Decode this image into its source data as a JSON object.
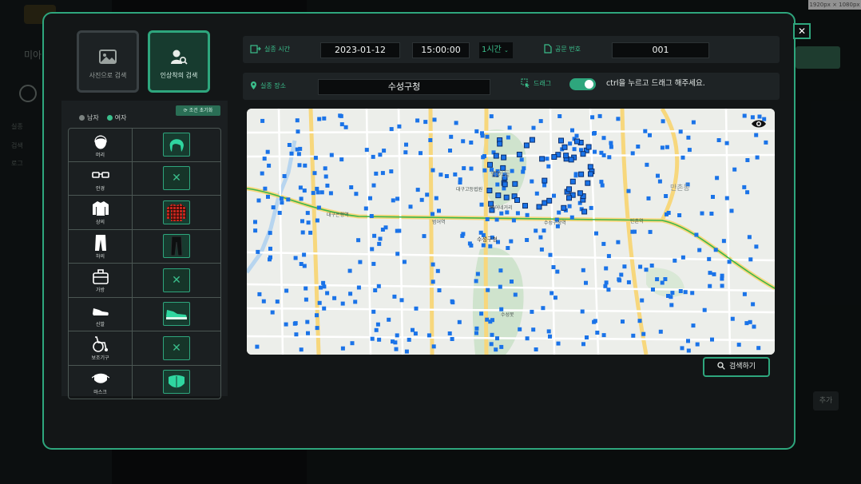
{
  "screen_size_label": "1920px × 1080px",
  "background": {
    "title": "미아",
    "nav_items": [
      "실종",
      "검색",
      "로그"
    ],
    "add_button": "추가"
  },
  "modal": {
    "tabs": [
      {
        "label": "사진으로 검색",
        "icon": "image-icon",
        "active": false
      },
      {
        "label": "인상착의 검색",
        "icon": "person-search-icon",
        "active": true
      }
    ],
    "gender": {
      "male": "남자",
      "female": "여자",
      "selected": "female"
    },
    "reset_label": "조건 초기화",
    "attributes": [
      {
        "label": "머리",
        "icon": "hair-icon",
        "value": "hair-green"
      },
      {
        "label": "안경",
        "icon": "glasses-icon",
        "value": "none"
      },
      {
        "label": "상의",
        "icon": "shirt-icon",
        "value": "plaid-shirt-red"
      },
      {
        "label": "하의",
        "icon": "pants-icon",
        "value": "pants-black"
      },
      {
        "label": "가방",
        "icon": "bag-icon",
        "value": "none"
      },
      {
        "label": "신발",
        "icon": "shoe-icon",
        "value": "sneaker-green"
      },
      {
        "label": "보조기구",
        "icon": "wheelchair-icon",
        "value": "none"
      },
      {
        "label": "마스크",
        "icon": "mask-icon",
        "value": "mask-green"
      }
    ],
    "missing_time": {
      "label": "실종 시간",
      "date": "2023-01-12",
      "time": "15:00:00",
      "range": "1시간"
    },
    "notice_number": {
      "label": "공문 번호",
      "value": "001"
    },
    "missing_place": {
      "label": "실종 장소",
      "value": "수성구청"
    },
    "drag": {
      "label": "드래그",
      "enabled": true,
      "hint": "ctrl을 누르고 드래그 해주세요."
    },
    "map": {
      "labels": [
        "대구은행역",
        "범어역",
        "수성구청역",
        "만촌역",
        "수성구청",
        "범어네거리",
        "대구고등법원",
        "수성못",
        "만촌동",
        "범어동"
      ],
      "accent": "#1a73e8"
    },
    "search_button": "검색하기",
    "accent_color": "#2ea67d"
  }
}
